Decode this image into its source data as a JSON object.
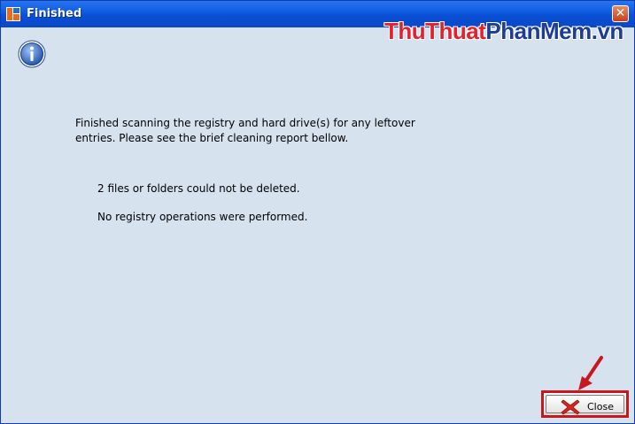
{
  "window": {
    "title": "Finished",
    "close_glyph": "✕"
  },
  "watermark": {
    "part1": "Thu",
    "part2": "Thuat",
    "part3": "Phan",
    "part4": "Mem",
    "part5": ".vn"
  },
  "content": {
    "message": "Finished scanning the registry and hard drive(s) for any leftover entries. Please see the brief cleaning report bellow.",
    "report_files": "2 files or folders could not be deleted.",
    "report_registry": "No registry operations were performed."
  },
  "buttons": {
    "close_label": "Close"
  },
  "icons": {
    "app": "app-icon",
    "info": "info-icon",
    "close_button_icon": "red-x-icon",
    "annotation": "red-arrow-icon"
  },
  "colors": {
    "titlebar": "#0c5ae0",
    "background": "#d7e2ef",
    "highlight": "#c8171d",
    "watermark_red": "#e4202e",
    "watermark_blue": "#1f3c96"
  }
}
